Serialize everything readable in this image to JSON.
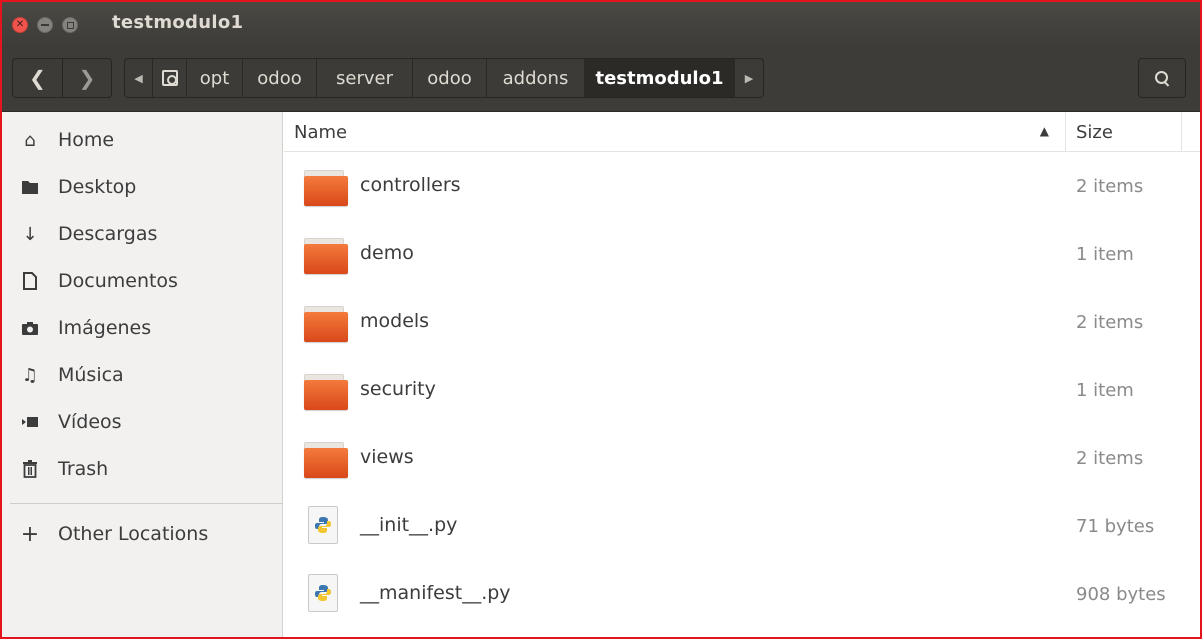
{
  "window": {
    "title": "testmodulo1"
  },
  "toolbar": {
    "breadcrumbs": [
      "opt",
      "odoo",
      "server",
      "odoo",
      "addons",
      "testmodulo1"
    ]
  },
  "sidebar": {
    "items": [
      {
        "label": "Home",
        "icon": "home-icon"
      },
      {
        "label": "Desktop",
        "icon": "folder-icon"
      },
      {
        "label": "Descargas",
        "icon": "download-icon"
      },
      {
        "label": "Documentos",
        "icon": "document-icon"
      },
      {
        "label": "Imágenes",
        "icon": "camera-icon"
      },
      {
        "label": "Música",
        "icon": "music-icon"
      },
      {
        "label": "Vídeos",
        "icon": "video-icon"
      },
      {
        "label": "Trash",
        "icon": "trash-icon"
      }
    ],
    "other_locations": "Other Locations"
  },
  "list": {
    "columns": {
      "name": "Name",
      "size": "Size"
    },
    "files": [
      {
        "name": "controllers",
        "size": "2 items",
        "kind": "folder"
      },
      {
        "name": "demo",
        "size": "1 item",
        "kind": "folder"
      },
      {
        "name": "models",
        "size": "2 items",
        "kind": "folder"
      },
      {
        "name": "security",
        "size": "1 item",
        "kind": "folder"
      },
      {
        "name": "views",
        "size": "2 items",
        "kind": "folder"
      },
      {
        "name": "__init__.py",
        "size": "71 bytes",
        "kind": "python"
      },
      {
        "name": "__manifest__.py",
        "size": "908 bytes",
        "kind": "python"
      }
    ]
  },
  "colors": {
    "titlebar": "#3d3c38",
    "accent_border": "#e3141b",
    "folder": "#f07746"
  }
}
